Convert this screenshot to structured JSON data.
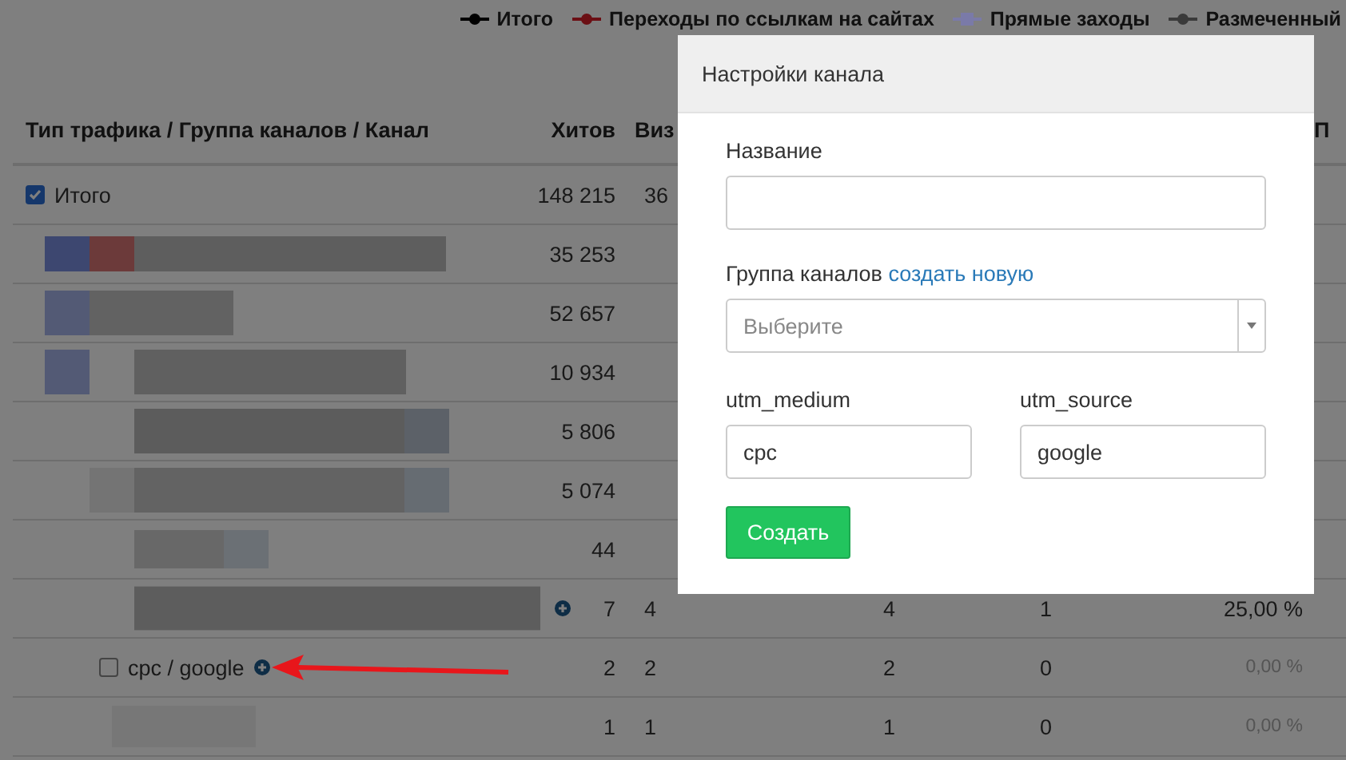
{
  "legend": [
    {
      "label": "Итого",
      "kind": "line",
      "color": "#000000"
    },
    {
      "label": "Переходы по ссылкам на сайтах",
      "kind": "line",
      "color": "#6b0f14"
    },
    {
      "label": "Прямые заходы",
      "kind": "square",
      "color": "#7a7aa8"
    },
    {
      "label": "Размеченный",
      "kind": "line",
      "color": "#3a3a3a"
    }
  ],
  "table": {
    "columns": [
      "Тип трафика / Группа каналов / Канал",
      "Хитов",
      "Виз",
      "П"
    ],
    "rows": [
      {
        "kind": "total",
        "label": "Итого",
        "checked": true,
        "hits": "148 215",
        "visits": "36"
      },
      {
        "kind": "redacted",
        "hits": "35 253"
      },
      {
        "kind": "redacted",
        "hits": "52 657"
      },
      {
        "kind": "redacted",
        "hits": "10 934"
      },
      {
        "kind": "redacted",
        "hits": "5 806"
      },
      {
        "kind": "redacted",
        "hits": "5 074"
      },
      {
        "kind": "redacted",
        "hits": "44"
      },
      {
        "kind": "redacted",
        "plus": true,
        "hits": "7",
        "visits": "4",
        "column_4": "4",
        "column_5": "1",
        "column_6": "25,00 %",
        "muted": false
      },
      {
        "kind": "channel",
        "label": "cpc / google",
        "checked": false,
        "plus": true,
        "hits": "2",
        "visits": "2",
        "column_4": "2",
        "column_5": "0",
        "column_6": "0,00 %",
        "muted": true
      },
      {
        "kind": "redacted",
        "hits": "1",
        "visits": "1",
        "column_4": "1",
        "column_5": "0",
        "column_6": "0,00 %",
        "muted": true
      }
    ]
  },
  "modal": {
    "title": "Настройки канала",
    "name_label": "Название",
    "group_label": "Группа каналов",
    "group_link": "создать новую",
    "group_placeholder": "Выберите",
    "medium_label": "utm_medium",
    "medium_value": "cpc",
    "source_label": "utm_source",
    "source_value": "google",
    "submit": "Создать"
  }
}
